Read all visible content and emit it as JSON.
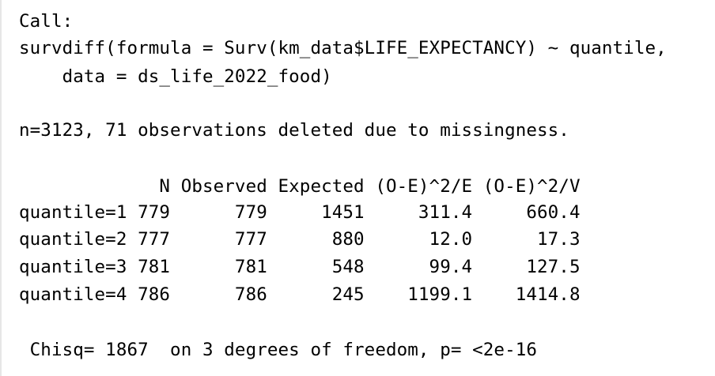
{
  "console": {
    "call_header": "Call:",
    "call_line1": "survdiff(formula = Surv(km_data$LIFE_EXPECTANCY) ~ quantile,",
    "call_line2": "    data = ds_life_2022_food)",
    "n_info": "n=3123, 71 observations deleted due to missingness.",
    "table_header": "             N Observed Expected (O-E)^2/E (O-E)^2/V",
    "rows": [
      "quantile=1 779      779     1451     311.4     660.4",
      "quantile=2 777      777      880      12.0      17.3",
      "quantile=3 781      781      548      99.4     127.5",
      "quantile=4 786      786      245    1199.1    1414.8"
    ],
    "chisq_line": " Chisq= 1867  on 3 degrees of freedom, p= <2e-16"
  }
}
